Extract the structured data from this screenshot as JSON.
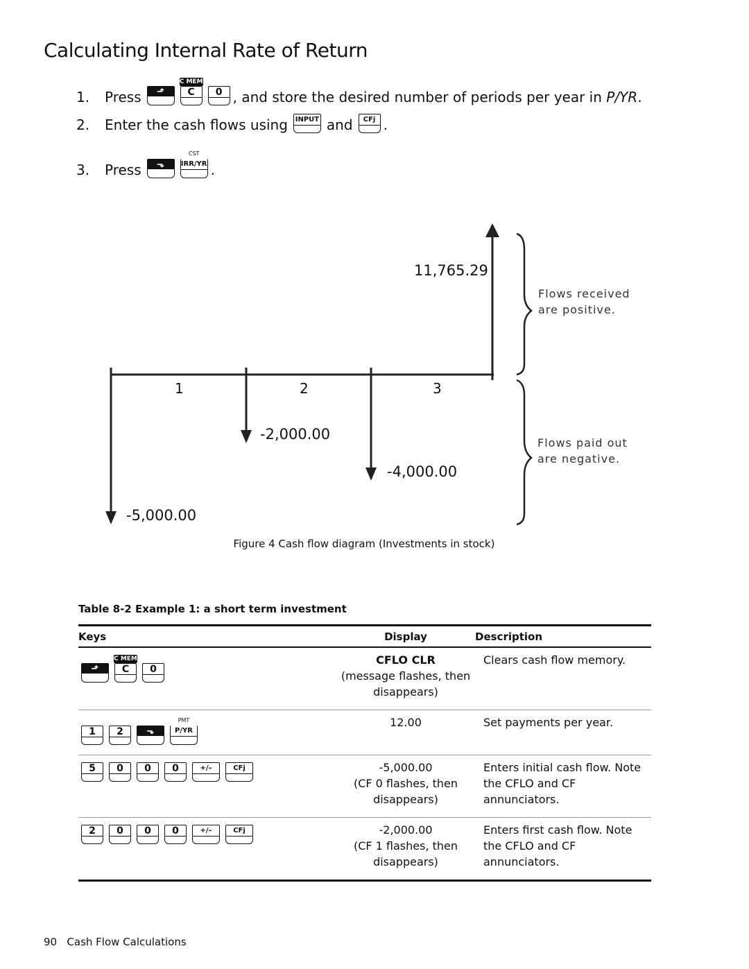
{
  "title": "Calculating Internal Rate of Return",
  "steps": [
    {
      "num": "1.",
      "pre": "Press",
      "keys": [
        {
          "type": "shift-up"
        },
        {
          "label": "C",
          "shift": "C MEM",
          "shiftStyle": "rev"
        },
        {
          "label": "0"
        }
      ],
      "post": ", and store the desired number of periods per year in ",
      "italic": "P/YR",
      "end": "."
    },
    {
      "num": "2.",
      "pre": "Enter the cash flows using",
      "keys": [
        {
          "label": "INPUT"
        }
      ],
      "mid": "and",
      "keys2": [
        {
          "label": "CFj"
        }
      ],
      "end": "."
    },
    {
      "num": "3.",
      "pre": "Press",
      "keys": [
        {
          "type": "shift-down"
        },
        {
          "label": "IRR/YR",
          "shift": "CST",
          "shiftStyle": "pl",
          "shifted": true
        }
      ],
      "end": "."
    }
  ],
  "diagram": {
    "received": "11,765.29",
    "periods": [
      "1",
      "2",
      "3"
    ],
    "flows": [
      "-5,000.00",
      "-2,000.00",
      "-4,000.00"
    ],
    "note_positive": [
      "Flows received",
      "are positive."
    ],
    "note_negative": [
      "Flows paid out",
      "are negative."
    ]
  },
  "figure_caption": "Figure 4  Cash flow diagram (Investments in stock)",
  "table": {
    "caption": "Table 8-2  Example 1: a short term investment",
    "headers": [
      "Keys",
      "Display",
      "Description"
    ],
    "rows": [
      {
        "keys": [
          {
            "type": "shift-up"
          },
          {
            "label": "C",
            "shift": "C MEM",
            "shiftStyle": "rev"
          },
          {
            "label": "0"
          }
        ],
        "display": "CFLO CLR",
        "display_bold": true,
        "display_note": "(message flashes, then disappears)",
        "description": "Clears cash flow memory."
      },
      {
        "keys": [
          {
            "label": "1"
          },
          {
            "label": "2"
          },
          {
            "type": "shift-down"
          },
          {
            "label": "P/YR",
            "shift": "PMT",
            "shiftStyle": "pl",
            "shifted": true
          }
        ],
        "display": "12.00",
        "display_note": "",
        "description": "Set payments per year."
      },
      {
        "keys": [
          {
            "label": "5"
          },
          {
            "label": "0"
          },
          {
            "label": "0"
          },
          {
            "label": "0"
          },
          {
            "label": "+/–",
            "wide": true
          },
          {
            "label": "CFj",
            "wide": true
          }
        ],
        "display": "-5,000.00",
        "display_note": "(CF 0 flashes, then disappears)",
        "description": "Enters initial cash flow. Note the CFLO and CF annunciators."
      },
      {
        "keys": [
          {
            "label": "2"
          },
          {
            "label": "0"
          },
          {
            "label": "0"
          },
          {
            "label": "0"
          },
          {
            "label": "+/–",
            "wide": true
          },
          {
            "label": "CFj",
            "wide": true
          }
        ],
        "display": "-2,000.00",
        "display_note": "(CF 1 flashes, then disappears)",
        "description": "Enters first cash flow. Note the CFLO and CF annunciators."
      }
    ]
  },
  "footer": {
    "page": "90",
    "section": "Cash Flow Calculations"
  }
}
